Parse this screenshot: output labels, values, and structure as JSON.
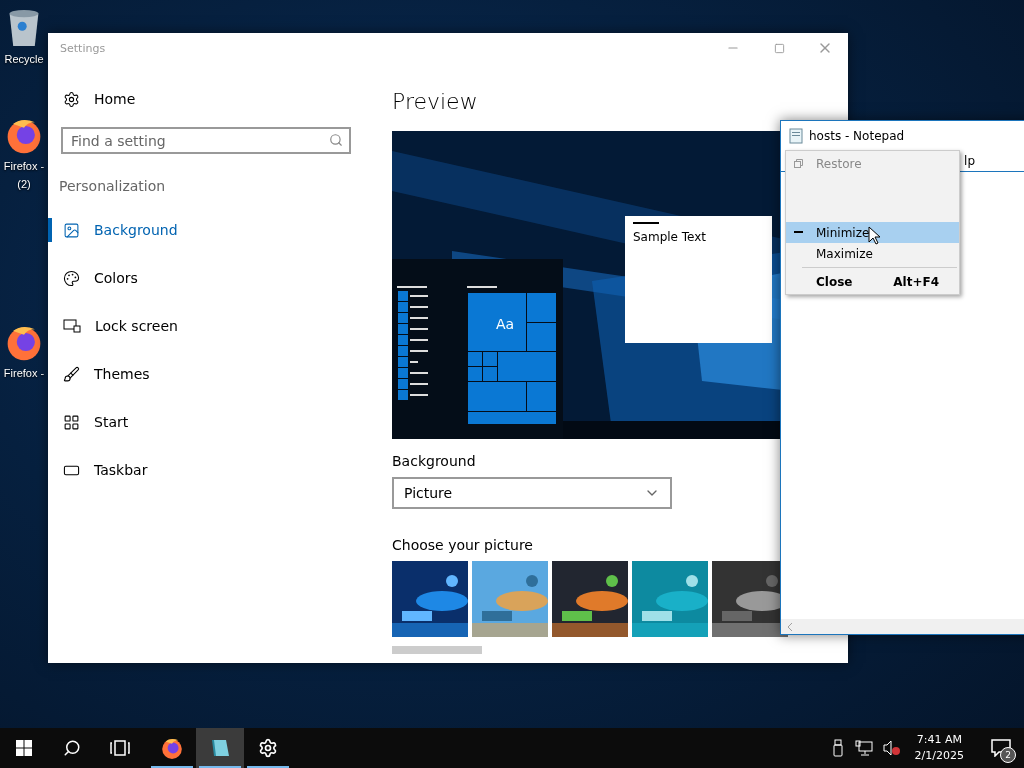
{
  "desktop": {
    "icons": [
      {
        "kind": "recycle",
        "lines": [
          "Recycle"
        ]
      },
      {
        "kind": "firefox",
        "lines": [
          "Firefox -",
          "(2)"
        ]
      },
      {
        "kind": "firefox",
        "lines": [
          "Firefox -"
        ]
      }
    ]
  },
  "settings": {
    "title": "Settings",
    "home": "Home",
    "search": {
      "placeholder": "Find a setting"
    },
    "section": "Personalization",
    "nav": [
      {
        "label": "Background",
        "selected": true
      },
      {
        "label": "Colors",
        "selected": false
      },
      {
        "label": "Lock screen",
        "selected": false
      },
      {
        "label": "Themes",
        "selected": false
      },
      {
        "label": "Start",
        "selected": false
      },
      {
        "label": "Taskbar",
        "selected": false
      }
    ],
    "preview": {
      "heading": "Preview",
      "tile_label": "Aa",
      "sample_text": "Sample Text"
    },
    "background": {
      "label": "Background",
      "value": "Picture"
    },
    "choose": {
      "label": "Choose your picture"
    }
  },
  "notepad": {
    "title": "hosts - Notepad",
    "menu_fragment": "lp"
  },
  "system_menu": {
    "items": [
      {
        "label": "Restore",
        "disabled": true,
        "selected": false,
        "default": false
      },
      {
        "label": "Minimize",
        "disabled": false,
        "selected": true,
        "default": false
      },
      {
        "label": "Maximize",
        "disabled": false,
        "selected": false,
        "default": false
      },
      {
        "label": "Close",
        "shortcut": "Alt+F4",
        "disabled": false,
        "selected": false,
        "default": true
      }
    ]
  },
  "taskbar": {
    "apps": [
      {
        "kind": "firefox",
        "active": false
      },
      {
        "kind": "notepad",
        "active": true
      },
      {
        "kind": "settings",
        "active": false
      }
    ],
    "clock": {
      "time": "7:41 AM",
      "date": "2/1/2025"
    },
    "notifications": {
      "count": "2"
    }
  }
}
